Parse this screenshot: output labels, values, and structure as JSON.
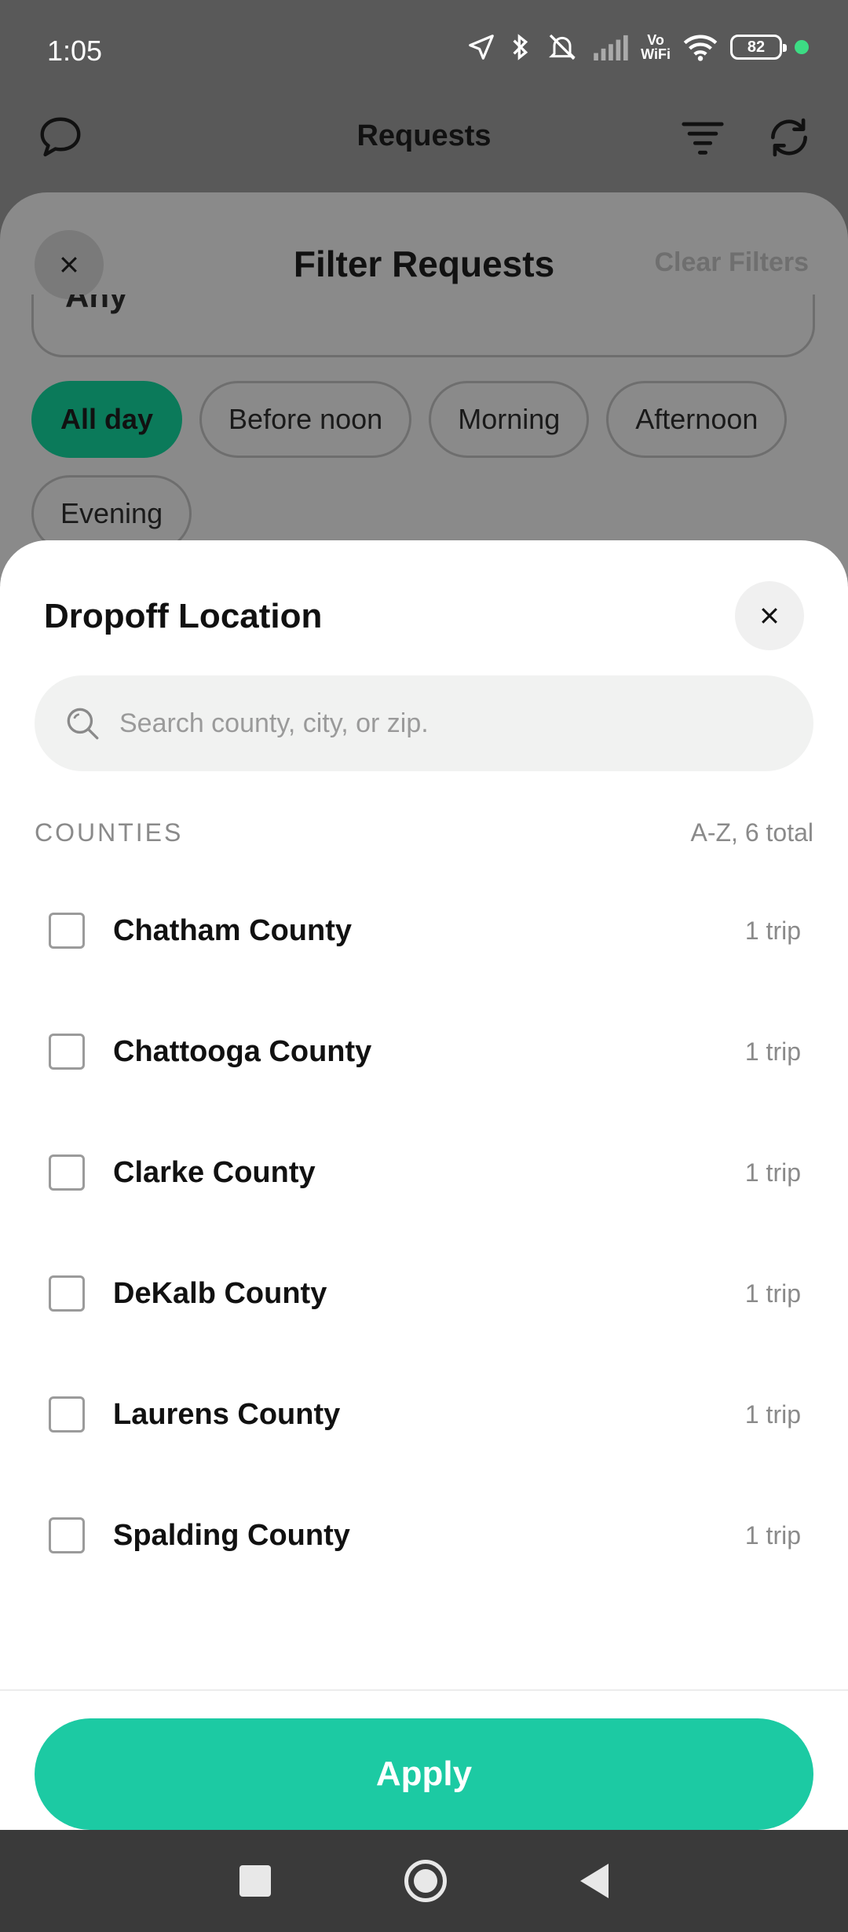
{
  "status_bar": {
    "time": "1:05",
    "network_label_top": "Vo",
    "network_label_bottom": "WiFi",
    "battery": "82"
  },
  "app_header": {
    "title": "Requests"
  },
  "filter_sheet": {
    "title": "Filter Requests",
    "clear_label": "Clear Filters",
    "any_value": "Any",
    "time_chips": [
      {
        "label": "All day",
        "active": true
      },
      {
        "label": "Before noon",
        "active": false
      },
      {
        "label": "Morning",
        "active": false
      },
      {
        "label": "Afternoon",
        "active": false
      },
      {
        "label": "Evening",
        "active": false
      }
    ]
  },
  "dropoff_sheet": {
    "title": "Dropoff Location",
    "search_placeholder": "Search county, city, or zip.",
    "section_label": "COUNTIES",
    "section_meta": "A-Z, 6 total",
    "counties": [
      {
        "name": "Chatham County",
        "trips": "1 trip",
        "checked": false
      },
      {
        "name": "Chattooga County",
        "trips": "1 trip",
        "checked": false
      },
      {
        "name": "Clarke County",
        "trips": "1 trip",
        "checked": false
      },
      {
        "name": "DeKalb County",
        "trips": "1 trip",
        "checked": false
      },
      {
        "name": "Laurens County",
        "trips": "1 trip",
        "checked": false
      },
      {
        "name": "Spalding County",
        "trips": "1 trip",
        "checked": false
      }
    ],
    "apply_label": "Apply"
  },
  "colors": {
    "accent": "#1ccaa3",
    "active_chip": "#0b7a5a"
  }
}
